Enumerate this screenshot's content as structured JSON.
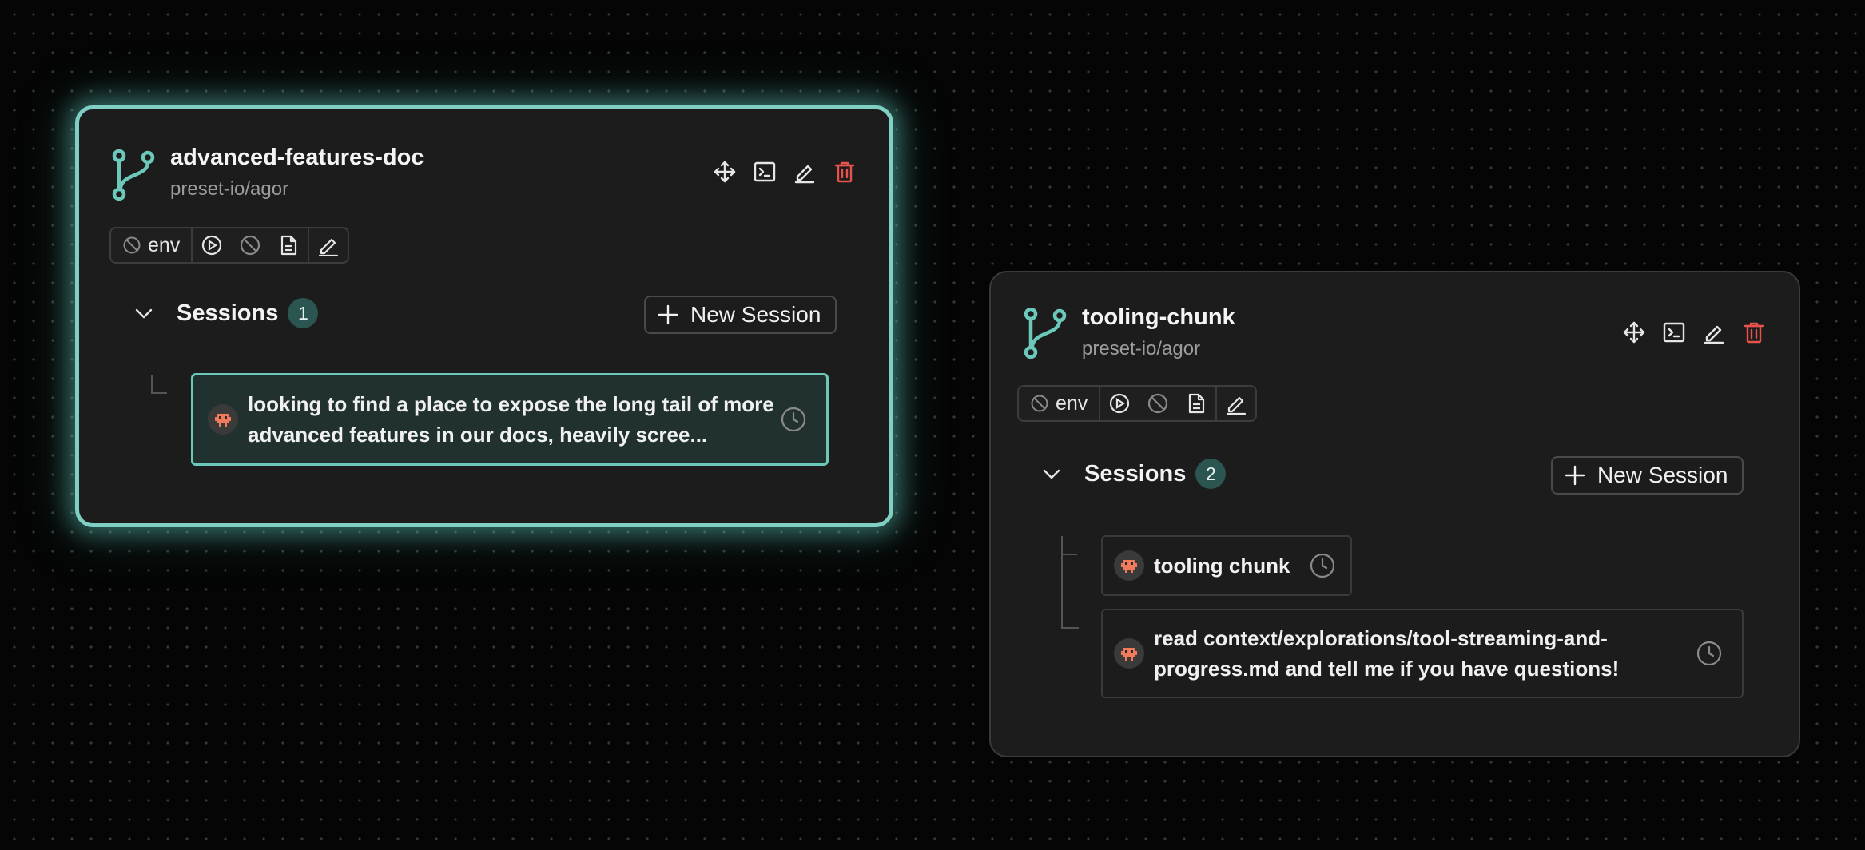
{
  "colors": {
    "accent": "#6cc8bb",
    "branch_icon": "#6cc8bb",
    "delete": "#e5534b",
    "badge_bg": "#2b5550",
    "avatar_accent": "#f07a5c"
  },
  "cards": [
    {
      "title": "advanced-features-doc",
      "repo": "preset-io/agor",
      "selected": true,
      "env_label": "env",
      "sessions_label": "Sessions",
      "sessions_count": "1",
      "new_session_label": "New Session",
      "sessions": [
        {
          "text": "looking to find a place to expose the long tail of more advanced features in our docs, heavily scree...",
          "active": true,
          "avatar_icon": "robot-icon",
          "status_icon": "clock-icon"
        }
      ]
    },
    {
      "title": "tooling-chunk",
      "repo": "preset-io/agor",
      "selected": false,
      "env_label": "env",
      "sessions_label": "Sessions",
      "sessions_count": "2",
      "new_session_label": "New Session",
      "sessions": [
        {
          "text": "tooling chunk",
          "active": false,
          "avatar_icon": "robot-icon",
          "status_icon": "clock-icon"
        },
        {
          "text": "read context/explorations/tool-streaming-and-progress.md and tell me if you have questions!",
          "active": false,
          "avatar_icon": "robot-icon",
          "status_icon": "clock-icon"
        }
      ]
    }
  ],
  "icons": {
    "card_actions": [
      "move-icon",
      "terminal-icon",
      "edit-icon",
      "trash-icon"
    ],
    "toolbar": [
      "ban-icon",
      "play-icon",
      "ban-icon",
      "file-icon",
      "edit-icon"
    ]
  }
}
